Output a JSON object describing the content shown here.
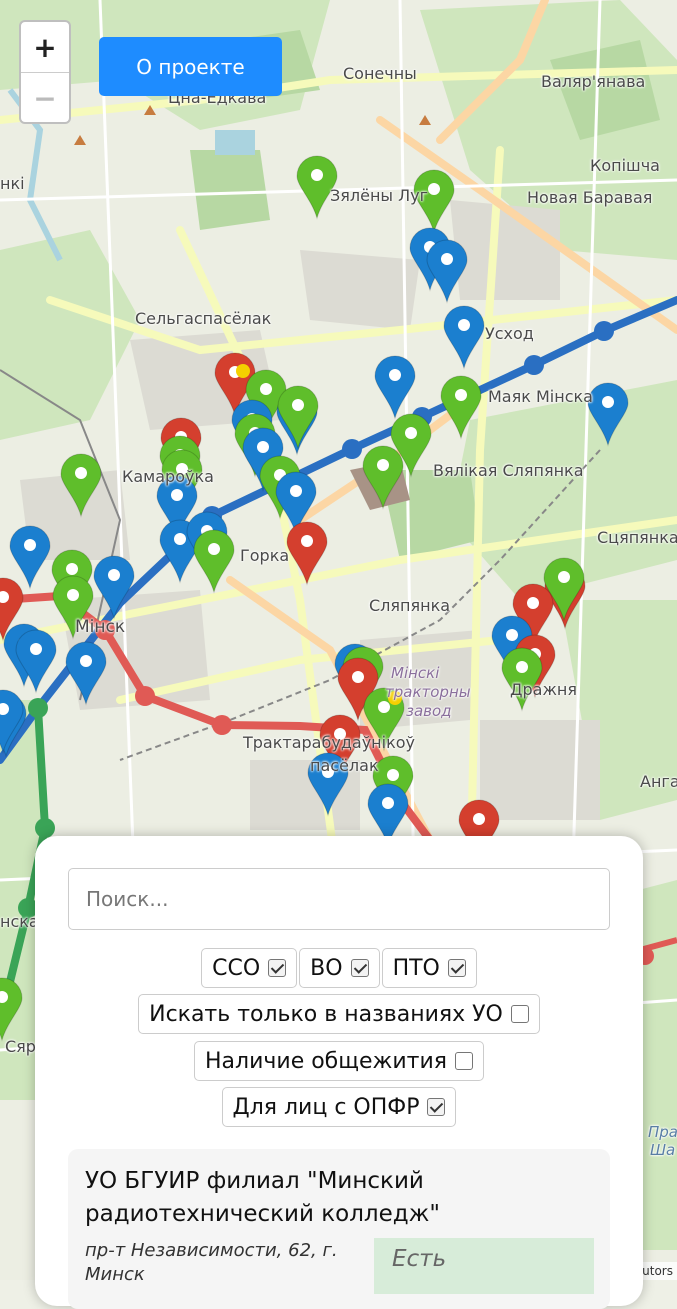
{
  "map": {
    "zoom_in": "+",
    "zoom_out": "−",
    "attribution": "utors",
    "places": [
      "Сонечны",
      "Цна-Едкава",
      "Валяр'янава",
      "нкі",
      "Копішча",
      "Новая Баравая",
      "Зялёны Луг",
      "Усход",
      "Сельгаспасёлак",
      "Маяк Мінска",
      "Вялікая Сляпянка",
      "Камароўка",
      "Сцяпянка",
      "Горка",
      "Сляпянка",
      "Мінскі",
      "тракторны",
      "завод",
      "Дражня",
      "Трактарабудаўнікоў",
      "пасёлак",
      "Мінск",
      "Анга",
      "нская",
      "Сяр",
      "Пра",
      "Ша"
    ]
  },
  "header": {
    "about_button": "О проекте"
  },
  "panel": {
    "search_placeholder": "Поиск...",
    "filters": {
      "sso": {
        "label": "ССО",
        "checked": true
      },
      "vo": {
        "label": "ВО",
        "checked": true
      },
      "pto": {
        "label": "ПТО",
        "checked": true
      },
      "names_only": {
        "label": "Искать только в названиях УО",
        "checked": false
      },
      "dormitory": {
        "label": "Наличие общежития",
        "checked": false
      },
      "opfr": {
        "label": "Для лиц с ОПФР",
        "checked": true
      }
    },
    "result": {
      "title": "УО БГУИР филиал \"Минский радиотехнический колледж\"",
      "address": "пр-т Независимости, 62, г. Минск",
      "badge": "Есть"
    }
  },
  "colors": {
    "accent": "#1e8cff",
    "pin_blue": "#1b7fcf",
    "pin_green": "#5fbe2b",
    "pin_red": "#d43f2e",
    "metro_blue": "#2a6fc2",
    "metro_red": "#e05a55",
    "metro_green": "#3aa457"
  }
}
